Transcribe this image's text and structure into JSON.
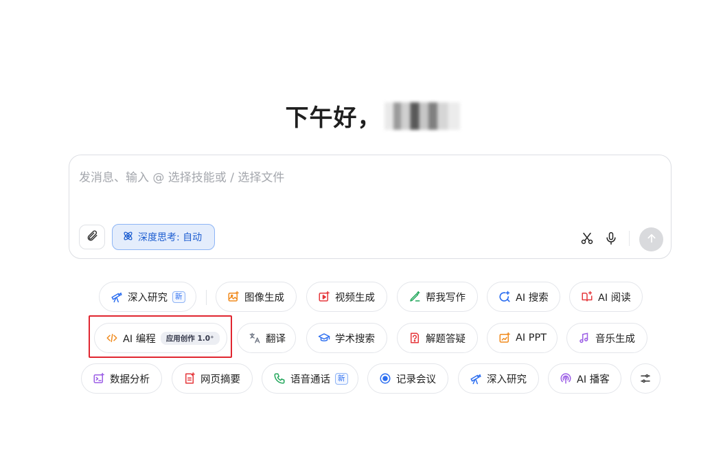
{
  "greeting": {
    "text": "下午好，"
  },
  "composer": {
    "placeholder": "发消息、输入 @ 选择技能或 / 选择文件",
    "deep_think_label": "深度思考: 自动"
  },
  "skills": {
    "row1": [
      {
        "label": "深入研究",
        "badge": "新",
        "icon": "telescope-icon"
      },
      {
        "label": "图像生成",
        "icon": "image-gen-icon"
      },
      {
        "label": "视频生成",
        "icon": "video-gen-icon"
      },
      {
        "label": "帮我写作",
        "icon": "pen-icon"
      },
      {
        "label": "AI 搜索",
        "icon": "ai-search-icon"
      },
      {
        "label": "AI 阅读",
        "icon": "book-icon"
      }
    ],
    "row2": [
      {
        "label": "AI 编程",
        "badge": "应用创作 1.0⁺",
        "icon": "code-icon"
      },
      {
        "label": "翻译",
        "icon": "translate-icon"
      },
      {
        "label": "学术搜索",
        "icon": "graduation-cap-icon"
      },
      {
        "label": "解题答疑",
        "icon": "question-icon"
      },
      {
        "label": "AI PPT",
        "icon": "ppt-icon"
      },
      {
        "label": "音乐生成",
        "icon": "music-icon"
      }
    ],
    "row3": [
      {
        "label": "数据分析",
        "icon": "data-analysis-icon"
      },
      {
        "label": "网页摘要",
        "icon": "webpage-summary-icon"
      },
      {
        "label": "语音通话",
        "badge": "新",
        "icon": "phone-icon"
      },
      {
        "label": "记录会议",
        "icon": "record-icon"
      },
      {
        "label": "深入研究",
        "icon": "telescope-icon"
      },
      {
        "label": "AI 播客",
        "icon": "podcast-icon"
      }
    ]
  },
  "colors": {
    "accent_blue": "#2a6df0",
    "orange": "#f08a1c",
    "red": "#e5373b",
    "green": "#21a65a",
    "purple": "#9b5de5",
    "highlight_red": "#e0252f"
  }
}
